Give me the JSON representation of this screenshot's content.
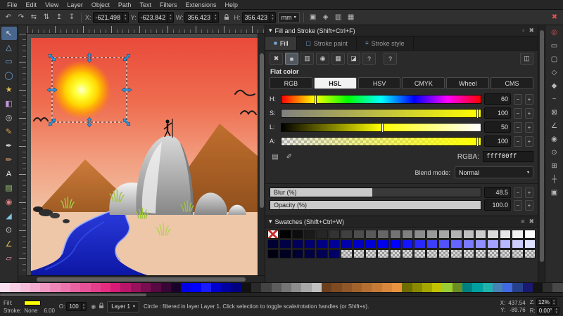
{
  "glyphs": {
    "close": "✖",
    "float": "▫",
    "panel_arrow": "▾",
    "hamburger": "≡",
    "dropdown": "▾",
    "spin_up": "▴",
    "spin_down": "▾",
    "help": "?",
    "eye": "◉",
    "plus": "+",
    "minus": "−"
  },
  "menu": {
    "items": [
      "File",
      "Edit",
      "View",
      "Layer",
      "Object",
      "Path",
      "Text",
      "Filters",
      "Extensions",
      "Help"
    ]
  },
  "toolbar": {
    "left_icons": [
      {
        "name": "rotate-ccw-icon",
        "glyph": "↶"
      },
      {
        "name": "rotate-cw-icon",
        "glyph": "↷"
      },
      {
        "name": "flip-horizontal-icon",
        "glyph": "⇆"
      },
      {
        "name": "flip-vertical-icon",
        "glyph": "⇅"
      },
      {
        "name": "raise-icon",
        "glyph": "↥"
      },
      {
        "name": "lower-icon",
        "glyph": "↧"
      }
    ],
    "fields": {
      "x": {
        "label": "X:",
        "value": "-621.498"
      },
      "y": {
        "label": "Y:",
        "value": "-623.842"
      },
      "w": {
        "label": "W:",
        "value": "356.423"
      },
      "h": {
        "label": "H:",
        "value": "356.423"
      }
    },
    "units": "mm",
    "right_icons": [
      {
        "name": "affect-stroke-icon",
        "glyph": "▣"
      },
      {
        "name": "affect-corners-icon",
        "glyph": "◈"
      },
      {
        "name": "affect-gradient-icon",
        "glyph": "▥"
      },
      {
        "name": "affect-pattern-icon",
        "glyph": "▦"
      }
    ],
    "close_glyph": "✖"
  },
  "tools": [
    {
      "name": "tool-selector",
      "glyph": "↖",
      "color": "#e8e8e8",
      "active": true
    },
    {
      "name": "tool-node-editor",
      "glyph": "△",
      "color": "#86b8e8"
    },
    {
      "name": "tool-rectangle",
      "glyph": "▭",
      "color": "#6aa2dc"
    },
    {
      "name": "tool-ellipse",
      "glyph": "◯",
      "color": "#6aa2dc"
    },
    {
      "name": "tool-star",
      "glyph": "★",
      "color": "#e2c250"
    },
    {
      "name": "tool-3d-box",
      "glyph": "◧",
      "color": "#c695d6"
    },
    {
      "name": "tool-spiral",
      "glyph": "◎",
      "color": "#cfcfcf"
    },
    {
      "name": "tool-pencil",
      "glyph": "✎",
      "color": "#e2a050"
    },
    {
      "name": "tool-pen",
      "glyph": "✒",
      "color": "#dcdcdc"
    },
    {
      "name": "tool-calligraphy",
      "glyph": "✏",
      "color": "#d29a70"
    },
    {
      "name": "tool-text",
      "glyph": "A",
      "color": "#f0f0f0"
    },
    {
      "name": "tool-gradient",
      "glyph": "▤",
      "color": "#9cc87a"
    },
    {
      "name": "tool-dropper",
      "glyph": "◉",
      "color": "#e08080"
    },
    {
      "name": "tool-paint-bucket",
      "glyph": "◢",
      "color": "#80c4e0"
    },
    {
      "name": "tool-zoom",
      "glyph": "⊙",
      "color": "#d8d8d8"
    },
    {
      "name": "tool-measure",
      "glyph": "∠",
      "color": "#e2c250"
    },
    {
      "name": "tool-eraser",
      "glyph": "▱",
      "color": "#e896b4"
    }
  ],
  "snapbar": [
    {
      "name": "snap-enable-icon",
      "glyph": "◎",
      "color": "#e05050"
    },
    {
      "name": "snap-bbox-icon",
      "glyph": "▭"
    },
    {
      "name": "snap-bbox-edge-icon",
      "glyph": "▢"
    },
    {
      "name": "snap-bbox-corner-icon",
      "glyph": "◇"
    },
    {
      "name": "snap-nodes-icon",
      "glyph": "◆"
    },
    {
      "name": "snap-path-icon",
      "glyph": "~"
    },
    {
      "name": "snap-intersection-icon",
      "glyph": "⊠"
    },
    {
      "name": "snap-cusp-icon",
      "glyph": "∠"
    },
    {
      "name": "snap-midpoint-icon",
      "glyph": "◉"
    },
    {
      "name": "snap-center-icon",
      "glyph": "⊙"
    },
    {
      "name": "snap-grid-icon",
      "glyph": "⊞"
    },
    {
      "name": "snap-guide-icon",
      "glyph": "┼"
    },
    {
      "name": "snap-page-icon",
      "glyph": "▣"
    }
  ],
  "canvas": {
    "selected_object": "sun-circle",
    "colors": {
      "sky_top": "#e94a3a",
      "sky_bottom": "#f0c3a4",
      "sun": "#ffff00",
      "mountain": "#c5762f",
      "ground": "#eec7a9",
      "river": "#1220c0",
      "rock_light": "#f0f0f0",
      "rock_dark": "#8e8e8e",
      "figure": "#111111",
      "grass": "#a5c93e"
    }
  },
  "fill_stroke": {
    "title": "Fill and Stroke (Shift+Ctrl+F)",
    "tabs": [
      {
        "label": "Fill",
        "icon": "■"
      },
      {
        "label": "Stroke paint",
        "icon": "▢"
      },
      {
        "label": "Stroke style",
        "icon": "≡"
      }
    ],
    "paint_buttons": [
      {
        "name": "no-paint-icon",
        "glyph": "✖"
      },
      {
        "name": "flat-color-icon",
        "glyph": "■",
        "active": true
      },
      {
        "name": "linear-gradient-icon",
        "glyph": "▥"
      },
      {
        "name": "radial-gradient-icon",
        "glyph": "◉"
      },
      {
        "name": "pattern-icon",
        "glyph": "▦"
      },
      {
        "name": "swatch-icon",
        "glyph": "◪"
      },
      {
        "name": "unknown-paint-icon",
        "glyph": "?"
      }
    ],
    "cms_button_glyph": "◫",
    "flat_color_label": "Flat color",
    "modes": [
      "RGB",
      "HSL",
      "HSV",
      "CMYK",
      "Wheel",
      "CMS"
    ],
    "active_mode": "HSL",
    "sliders": {
      "h": {
        "label": "H:",
        "value": "60"
      },
      "s": {
        "label": "S:",
        "value": "100"
      },
      "l": {
        "label": "L:",
        "value": "50"
      },
      "a": {
        "label": "A:",
        "value": "100"
      }
    },
    "picker_icons": [
      {
        "name": "color-palette-icon",
        "glyph": "▤"
      },
      {
        "name": "color-picker-icon",
        "glyph": "✐"
      }
    ],
    "rgba": {
      "label": "RGBA:",
      "value": "ffff00ff"
    },
    "blend": {
      "label": "Blend mode:",
      "value": "Normal"
    },
    "blur": {
      "label": "Blur (%)",
      "value": "48.5",
      "percent": 48.5
    },
    "opacity": {
      "label": "Opacity (%)",
      "value": "100.0",
      "percent": 100
    }
  },
  "swatches": {
    "title": "Swatches (Shift+Ctrl+W)",
    "rows": [
      [
        "none",
        "#000000",
        "#0d0d0d",
        "#1a1a1a",
        "#262626",
        "#333333",
        "#404040",
        "#4d4d4d",
        "#595959",
        "#666666",
        "#737373",
        "#808080",
        "#8c8c8c",
        "#999999",
        "#a6a6a6",
        "#b3b3b3",
        "#bfbfbf",
        "#cccccc",
        "#d9d9d9",
        "#e6e6e6",
        "#f2f2f2",
        "#ffffff"
      ],
      [
        "#000033",
        "#000047",
        "#00005c",
        "#000070",
        "#000085",
        "#000099",
        "#0000ad",
        "#0000c2",
        "#0000d6",
        "#0000eb",
        "#0000ff",
        "#1414ff",
        "#2929ff",
        "#3d3dff",
        "#5252ff",
        "#6666ff",
        "#7a7aff",
        "#8f8fff",
        "#a3a3ff",
        "#b8b8ff",
        "#ccccff",
        "#e0e0ff"
      ],
      [
        "#000011",
        "#000022",
        "#000033",
        "#000044",
        "#000055",
        "#000066",
        "checker",
        "checker",
        "checker",
        "checker",
        "checker",
        "checker",
        "checker",
        "checker",
        "checker",
        "checker",
        "checker",
        "checker",
        "checker",
        "checker",
        "checker",
        "checker"
      ]
    ]
  },
  "palette": [
    "#f9e0ee",
    "#f7cfe4",
    "#f5bdd9",
    "#f3abce",
    "#f099c3",
    "#ee87b8",
    "#ec75ad",
    "#e963a2",
    "#e75197",
    "#e43f8c",
    "#e22d81",
    "#d81b76",
    "#b8156a",
    "#98115d",
    "#780d50",
    "#580943",
    "#380536",
    "#180229",
    "#0000e6",
    "#0000ff",
    "#1a1aff",
    "#0000cc",
    "#0000a0",
    "#000080",
    "#111111",
    "#2a2a2a",
    "#434343",
    "#5c5c5c",
    "#757575",
    "#8e8e8e",
    "#a7a7a7",
    "#c0c0c0",
    "#6b3e1d",
    "#7d4a22",
    "#8f5627",
    "#a1622c",
    "#b36e31",
    "#c57a36",
    "#d7863b",
    "#e99240",
    "#6e6e00",
    "#8a8a00",
    "#a6a600",
    "#c2c200",
    "#9acd32",
    "#6b8e23",
    "#008080",
    "#00a0a0",
    "#20b2aa",
    "#4682b4",
    "#4169e1",
    "#27408b",
    "#191970",
    "#141414",
    "#2e2e2e",
    "#484848"
  ],
  "status": {
    "fill_label": "Fill:",
    "fill_color": "#ffff00",
    "stroke_label": "Stroke:",
    "stroke_value": "None",
    "stroke_width": "6.00",
    "opacity_label": "O:",
    "opacity_value": "100",
    "layer_name": "Layer 1",
    "message": "Circle : filtered in layer Layer 1. Click selection to toggle scale/rotation handles (or Shift+s).",
    "cursor": {
      "x_label": "X:",
      "x": "437.54",
      "y_label": "Y:",
      "y": "-89.76"
    },
    "zoom": {
      "label": "Z:",
      "value": "12",
      "unit": "%"
    },
    "rotation": {
      "label": "R:",
      "value": "0.00",
      "unit": "°"
    }
  }
}
